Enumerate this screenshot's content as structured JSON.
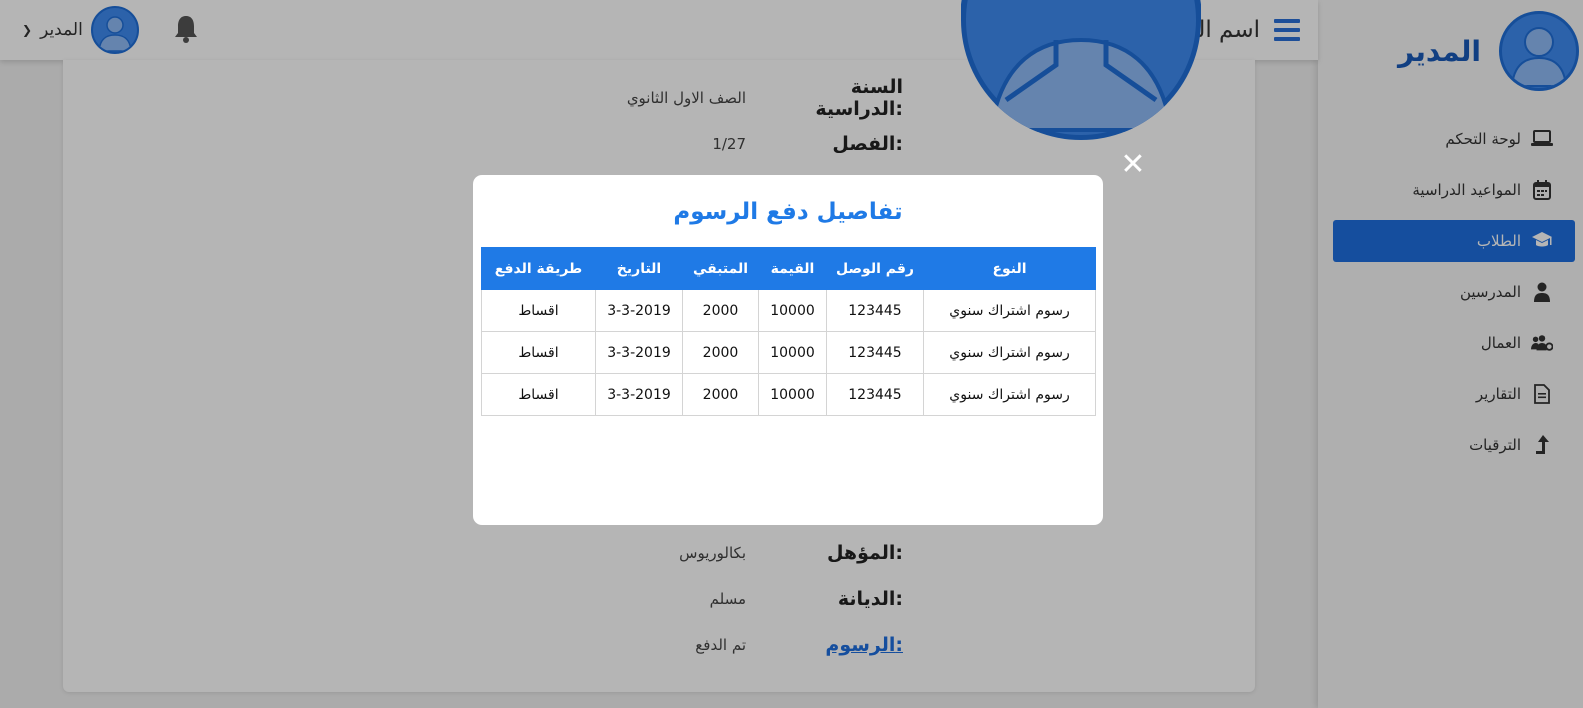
{
  "sidebar": {
    "brand_title": "المدير",
    "items": [
      {
        "label": "لوحة التحكم",
        "icon": "laptop-icon",
        "active": false
      },
      {
        "label": "المواعيد الدراسية",
        "icon": "calendar-icon",
        "active": false
      },
      {
        "label": "الطلاب",
        "icon": "graduation-cap-icon",
        "active": true
      },
      {
        "label": "المدرسين",
        "icon": "teacher-icon",
        "active": false
      },
      {
        "label": "العمال",
        "icon": "users-cog-icon",
        "active": false
      },
      {
        "label": "التقارير",
        "icon": "file-icon",
        "active": false
      },
      {
        "label": "الترقيات",
        "icon": "level-up-icon",
        "active": false
      }
    ]
  },
  "header": {
    "school_name": "اسم المدرسة",
    "user_name": "المدير"
  },
  "profile": {
    "fields": [
      {
        "label": "السنة الدراسية:",
        "value": "الصف الاول الثانوي",
        "link": false
      },
      {
        "label": "الفصل:",
        "value": "1/27",
        "link": false
      },
      {
        "label": "المؤهل:",
        "value": "بكالوريوس",
        "link": false
      },
      {
        "label": "الديانة:",
        "value": "مسلم",
        "link": false
      },
      {
        "label": "الرسوم:",
        "value": "تم الدفع",
        "link": true
      }
    ]
  },
  "modal": {
    "close_symbol": "✕",
    "title": "تفاصيل دفع الرسوم",
    "columns": [
      "النوع",
      "رقم الوصل",
      "القيمة",
      "المتبقي",
      "التاريخ",
      "طريقة الدفع"
    ],
    "rows": [
      [
        "رسوم اشتراك سنوي",
        "123445",
        "10000",
        "2000",
        "3-3-2019",
        "اقساط"
      ],
      [
        "رسوم اشتراك سنوي",
        "123445",
        "10000",
        "2000",
        "3-3-2019",
        "اقساط"
      ],
      [
        "رسوم اشتراك سنوي",
        "123445",
        "10000",
        "2000",
        "3-3-2019",
        "اقساط"
      ]
    ]
  },
  "colors": {
    "accent": "#1f7ae6",
    "active_nav": "#1e6fdf",
    "brand": "#1959b8"
  }
}
